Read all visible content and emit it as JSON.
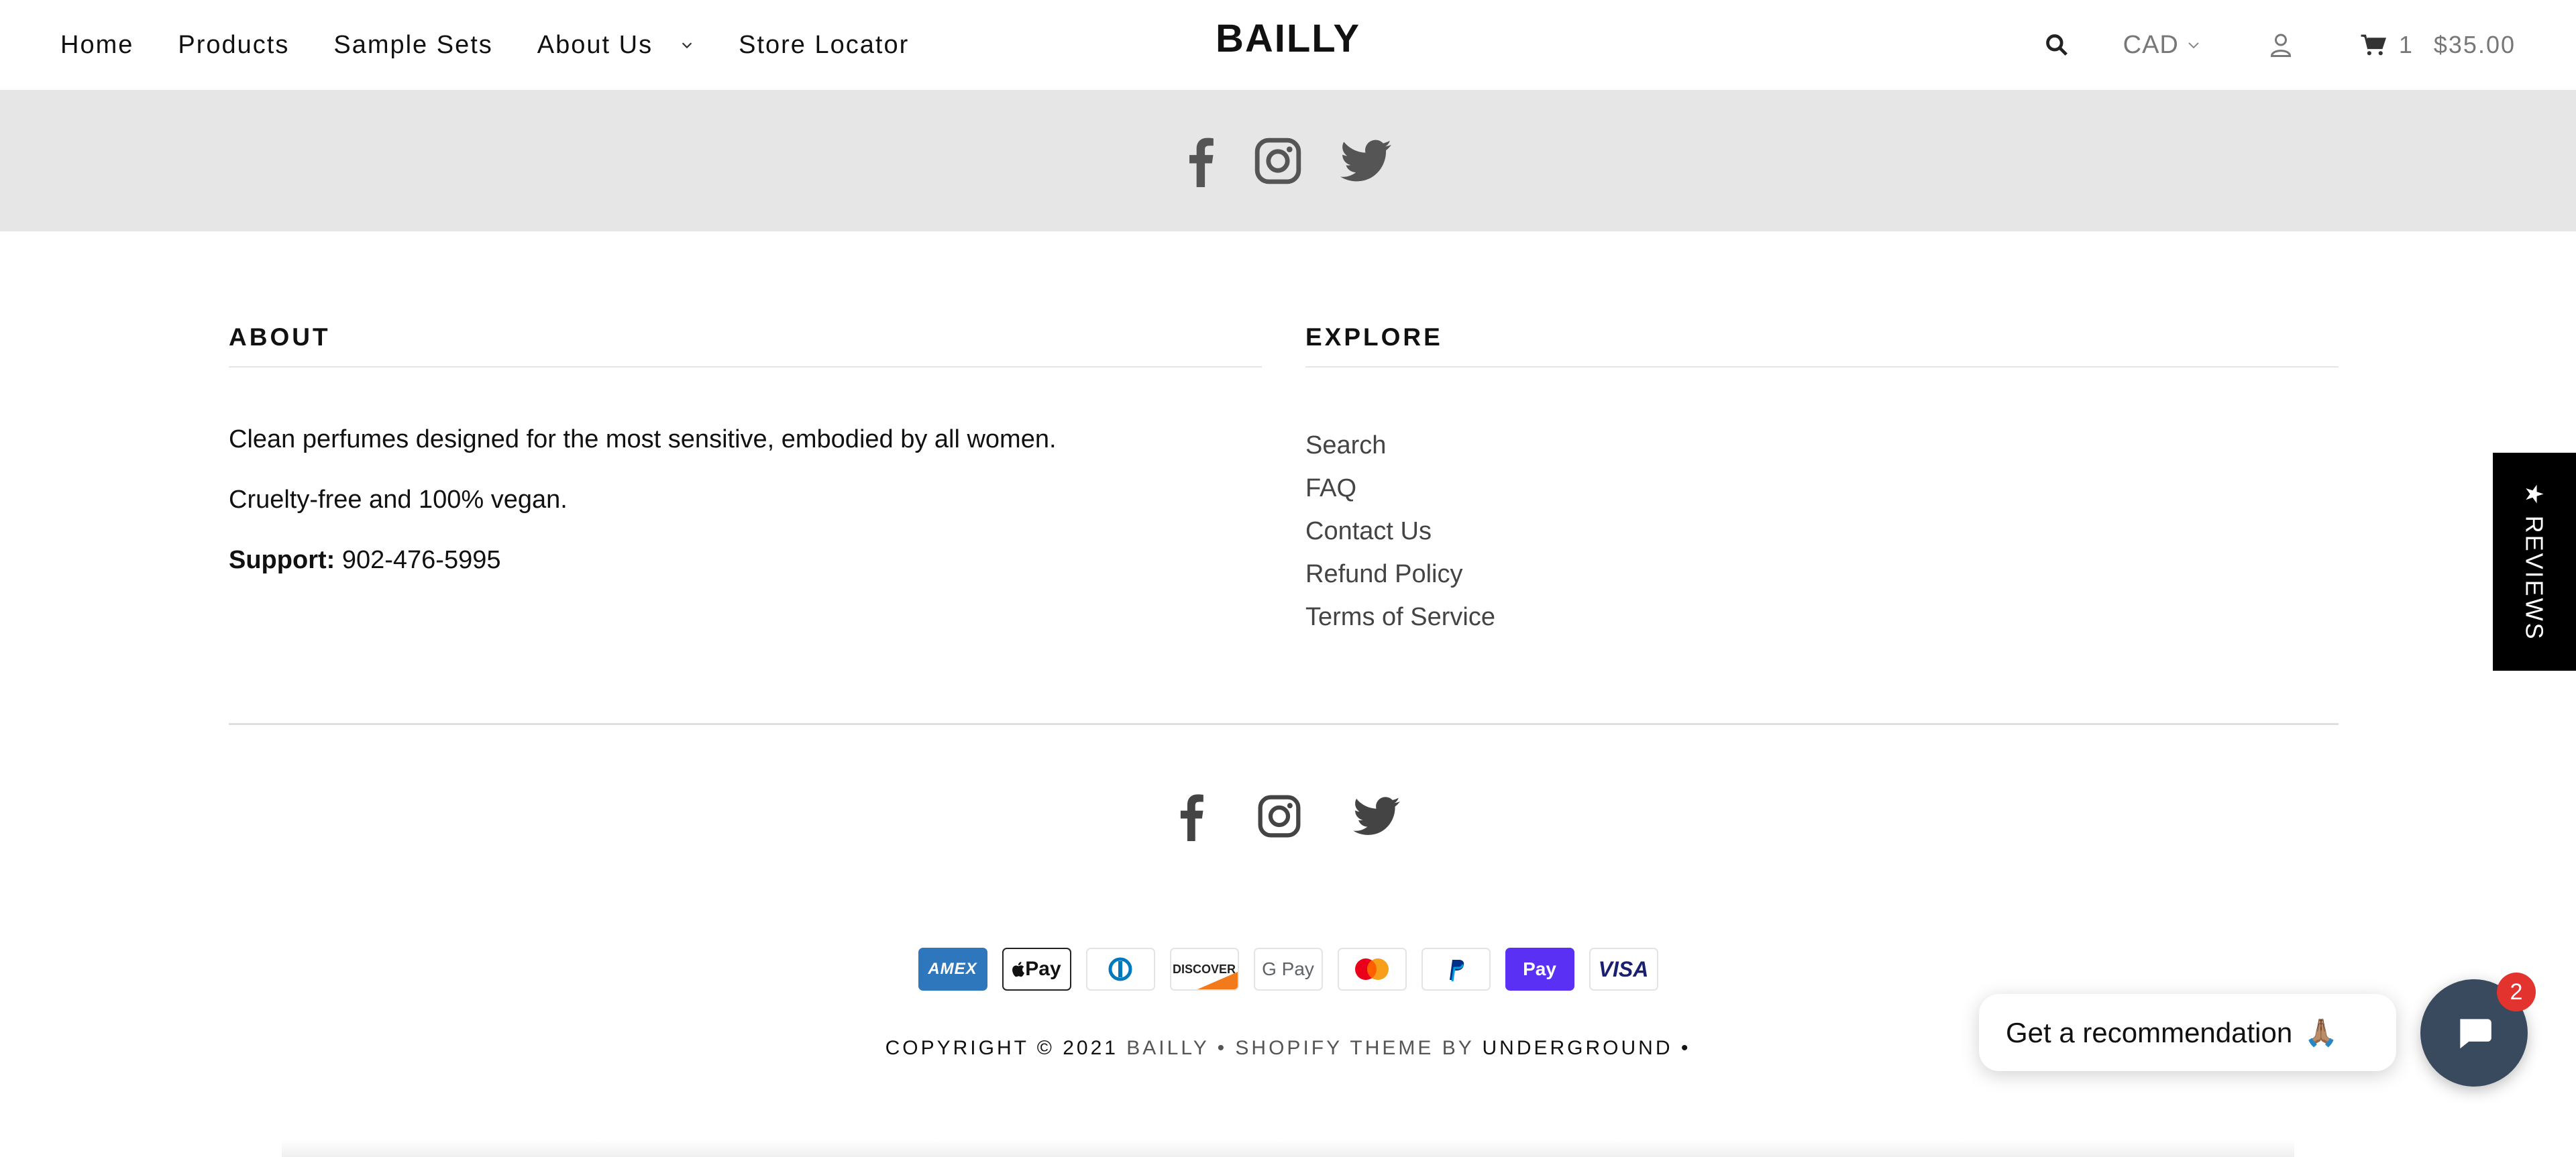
{
  "brand": {
    "name": "BAILLY"
  },
  "nav": {
    "items": [
      {
        "label": "Home"
      },
      {
        "label": "Products"
      },
      {
        "label": "Sample Sets"
      },
      {
        "label": "About Us"
      },
      {
        "label": "Store Locator"
      }
    ]
  },
  "header": {
    "currency": "CAD",
    "cart": {
      "count": "1",
      "total": "$35.00"
    },
    "icons": [
      "search-icon",
      "user-icon",
      "cart-icon",
      "chevron-down-icon"
    ]
  },
  "social": [
    "facebook-icon",
    "instagram-icon",
    "twitter-icon"
  ],
  "footer": {
    "about": {
      "heading": "ABOUT",
      "line1": "Clean perfumes designed for the most sensitive, embodied by all women.",
      "line2": "Cruelty-free and 100% vegan.",
      "support_label": "Support:",
      "support_value": " 902-476-5995"
    },
    "explore": {
      "heading": "EXPLORE",
      "links": [
        "Search",
        "FAQ",
        "Contact Us",
        "Refund Policy",
        "Terms of Service"
      ]
    },
    "payments": [
      "AMEX",
      "Pay",
      "Diners Club",
      "DISCOVER",
      "G Pay",
      "Mastercard",
      "PayPal",
      "Pay",
      "VISA"
    ],
    "copyright": {
      "prefix": "COPYRIGHT © 2021 ",
      "brand": "BAILLY",
      "middle": " • SHOPIFY THEME BY ",
      "by": "UNDERGROUND",
      "suffix": " •"
    }
  },
  "widgets": {
    "reviews_tab": "★ REVIEWS",
    "chat": {
      "prompt": "Get a recommendation",
      "emoji": "🙏🏽",
      "badge": "2"
    }
  },
  "colors": {
    "band": "#e6e6e6",
    "chat_button": "#3a4a5e",
    "badge": "#e2332f",
    "shop_pay": "#5a31f4",
    "amex": "#2e77bc"
  }
}
